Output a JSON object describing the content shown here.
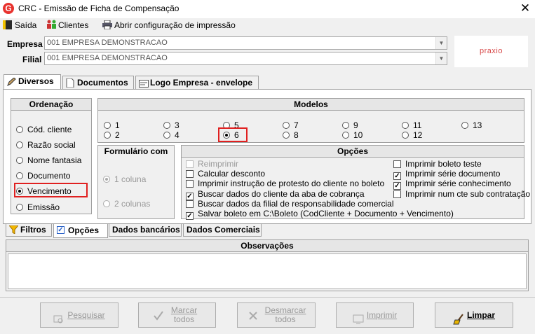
{
  "window": {
    "title": "CRC - Emissão de Ficha de Compensação",
    "logo_letter": "G",
    "close_glyph": "✕"
  },
  "menu": {
    "items": [
      {
        "label": "Saída",
        "icon": "door-exit-icon"
      },
      {
        "label": "Clientes",
        "icon": "people-icon"
      },
      {
        "label": "Abrir configuração de impressão",
        "icon": "printer-icon"
      }
    ]
  },
  "header": {
    "empresa_label": "Empresa",
    "empresa_value": "001 EMPRESA DEMONSTRACAO",
    "filial_label": "Filial",
    "filial_value": "001 EMPRESA DEMONSTRACAO",
    "brand": "praxio"
  },
  "tabs": [
    {
      "label": "Diversos",
      "active": true
    },
    {
      "label": "Documentos",
      "active": false
    },
    {
      "label": "Logo Empresa - envelope",
      "active": false
    }
  ],
  "ordenacao": {
    "title": "Ordenação",
    "options": [
      "Cód. cliente",
      "Razão social",
      "Nome fantasia",
      "Documento",
      "Vencimento",
      "Emissão"
    ],
    "selected": "Vencimento"
  },
  "modelos": {
    "title": "Modelos",
    "options": [
      "1",
      "3",
      "5",
      "7",
      "9",
      "11",
      "13",
      "2",
      "4",
      "6",
      "8",
      "10",
      "12"
    ],
    "selected": "6"
  },
  "formulario": {
    "title": "Formulário com",
    "options": [
      "1 coluna",
      "2 colunas"
    ],
    "selected": "1 coluna",
    "disabled": true
  },
  "opcoes": {
    "title": "Opções",
    "left": [
      {
        "label": "Reimprimir",
        "checked": false,
        "disabled": true
      },
      {
        "label": "Calcular desconto",
        "checked": false,
        "disabled": false
      },
      {
        "label": "Imprimir instrução de protesto do cliente no boleto",
        "checked": false,
        "disabled": false
      },
      {
        "label": "Buscar dados do cliente da aba de cobrança",
        "checked": true,
        "disabled": false
      },
      {
        "label": "Buscar dados da filial de responsabilidade comercial",
        "checked": false,
        "disabled": false
      },
      {
        "label": "Salvar boleto em C:\\Boleto (CodCliente + Documento + Vencimento)",
        "checked": true,
        "disabled": false
      }
    ],
    "right": [
      {
        "label": "Imprimir boleto teste",
        "checked": false
      },
      {
        "label": "Imprimir série documento",
        "checked": true
      },
      {
        "label": "Imprimir série conhecimento",
        "checked": true
      },
      {
        "label": "Imprimir num cte sub contratação",
        "checked": false
      }
    ]
  },
  "subtabs": [
    {
      "label": "Filtros",
      "active": false
    },
    {
      "label": "Opções",
      "active": true
    },
    {
      "label": "Dados bancários",
      "active": false
    },
    {
      "label": "Dados Comerciais",
      "active": false
    }
  ],
  "observacoes": {
    "title": "Observações",
    "text": ""
  },
  "buttons": {
    "pesquisar": "Pesquisar",
    "marcar_l1": "Marcar",
    "marcar_l2": "todos",
    "desmarcar_l1": "Desmarcar",
    "desmarcar_l2": "todos",
    "imprimir": "Imprimir",
    "limpar": "Limpar"
  },
  "colors": {
    "brand_red": "#e8322e",
    "highlight": "#e02020"
  }
}
